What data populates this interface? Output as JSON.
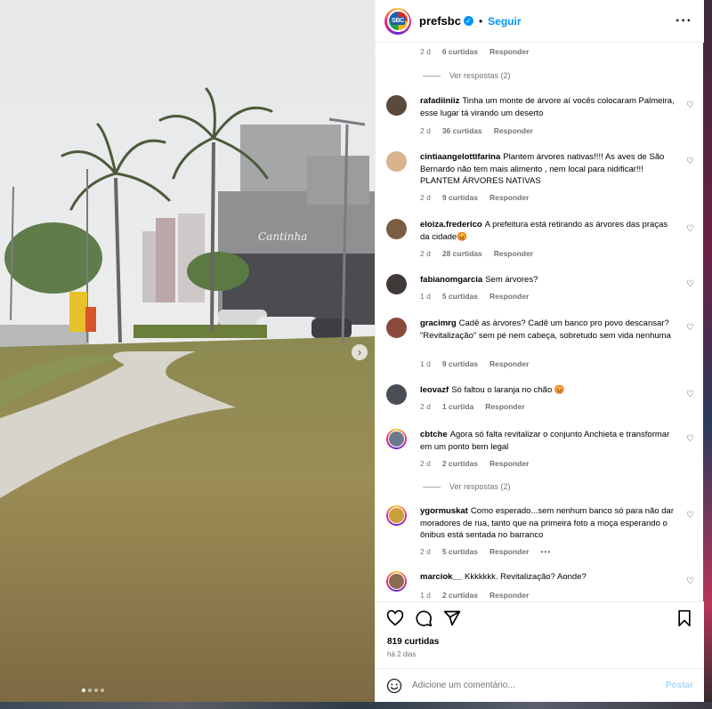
{
  "header": {
    "username": "prefsbc",
    "logo_text": "SBC",
    "verified_icon": "verified-badge-icon",
    "bullet": "•",
    "follow_label": "Seguir",
    "more_icon": "more-options-icon"
  },
  "top_meta": {
    "time": "2 d",
    "likes": "6 curtidas",
    "reply": "Responder"
  },
  "comments": [
    {
      "user": "rafadiiniiz",
      "text": "Tinha um monte de árvore aí vocês colocaram Palmeira, esse lugar tá virando um deserto",
      "time": "2 d",
      "likes": "36 curtidas",
      "reply": "Responder"
    },
    {
      "user": "cintiaangelottifarina",
      "text": "Plantem árvores nativas!!!! As aves de São Bernardo não tem mais alimento , nem local para nidificar!!! PLANTEM ÁRVORES NATIVAS",
      "time": "2 d",
      "likes": "9 curtidas",
      "reply": "Responder"
    },
    {
      "user": "eloiza.frederico",
      "text": "A prefeitura está retirando as árvores das praças da cidade😡",
      "time": "2 d",
      "likes": "28 curtidas",
      "reply": "Responder"
    },
    {
      "user": "fabianomgarcia",
      "text": "Sem árvores?",
      "time": "1 d",
      "likes": "5 curtidas",
      "reply": "Responder"
    },
    {
      "user": "gracimrg",
      "text": "Cadê as árvores? Cadê um banco pro povo descansar? \"Revitalização\" sem pé nem cabeça, sobretudo sem vida nenhuma",
      "time": "1 d",
      "likes": "9 curtidas",
      "reply": "Responder"
    },
    {
      "user": "leovazf",
      "text": "Só faltou o laranja no chão 😡",
      "time": "2 d",
      "likes": "1 curtida",
      "reply": "Responder"
    },
    {
      "user": "cbtche",
      "text": "Agora só falta revitalizar o conjunto Anchieta e transformar em um ponto bem legal",
      "time": "2 d",
      "likes": "2 curtidas",
      "reply": "Responder"
    },
    {
      "user": "ygormuskat",
      "text": "Como esperado...sem nenhum banco só para não dar moradores de rua, tanto que na primeira foto a moça esperando o ônibus está sentada no barranco",
      "time": "2 d",
      "likes": "5 curtidas",
      "reply": "Responder",
      "extra": "•••"
    },
    {
      "user": "marciok__",
      "text": "Kkkkkkk. Revitalização? Aonde?",
      "time": "1 d",
      "likes": "2 curtidas",
      "reply": "Responder"
    }
  ],
  "view_replies": [
    "Ver respostas (2)",
    "Ver respostas (2)"
  ],
  "actions": {
    "likes": "819 curtidas",
    "time_ago": "há 2 dias",
    "icons": [
      "heart-icon",
      "comment-icon",
      "share-icon",
      "bookmark-icon"
    ]
  },
  "add_comment": {
    "placeholder": "Adicione um comentário...",
    "post_label": "Postar",
    "emoji_icon": "emoji-icon"
  },
  "carousel": {
    "slide_count": 4,
    "active_slide": 1,
    "next_icon": "chevron-right-icon"
  },
  "colors": {
    "accent": "#0095f6",
    "muted": "#737373",
    "post_disabled": "#a9d6fb"
  }
}
